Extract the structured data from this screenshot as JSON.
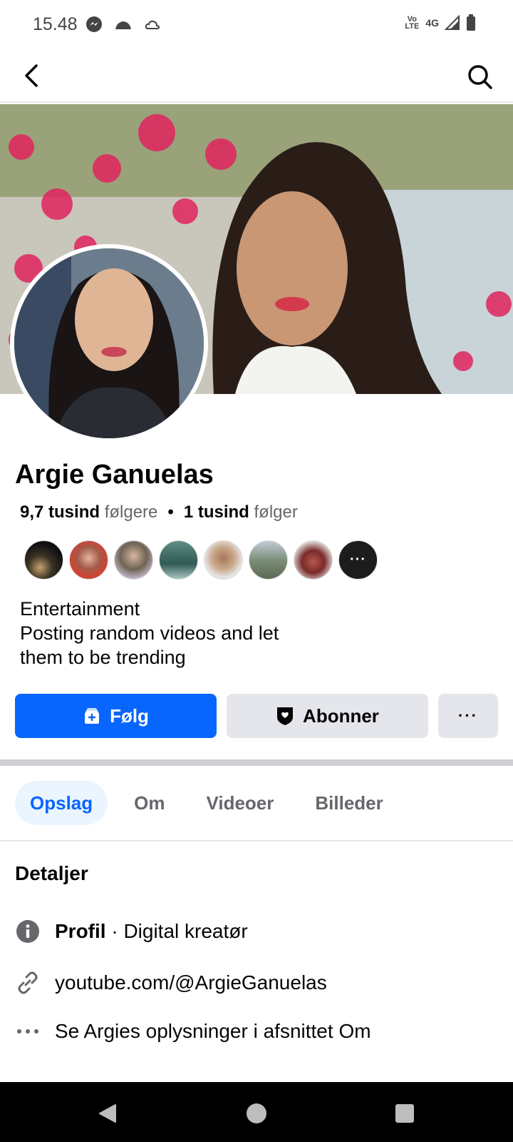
{
  "status_bar": {
    "time": "15.48",
    "network": "4G",
    "volte": "Vo LTE"
  },
  "profile": {
    "name": "Argie Ganuelas",
    "followers_count": "9,7 tusind",
    "followers_label": "følgere",
    "following_count": "1 tusind",
    "following_label": "følger",
    "separator": "•",
    "bio_lines": [
      "Entertainment",
      "Posting random videos and let",
      "them to be trending"
    ]
  },
  "actions": {
    "follow_label": "Følg",
    "subscribe_label": "Abonner",
    "more_label": "···"
  },
  "tabs": [
    {
      "label": "Opslag",
      "active": true
    },
    {
      "label": "Om",
      "active": false
    },
    {
      "label": "Videoer",
      "active": false
    },
    {
      "label": "Billeder",
      "active": false
    }
  ],
  "details": {
    "title": "Detaljer",
    "profile_label": "Profil",
    "profile_value": " · Digital kreatør",
    "link": "youtube.com/@ArgieGanuelas",
    "see_more": "Se Argies oplysninger i afsnittet Om"
  },
  "friends_more_label": "···",
  "icons": {
    "back": "back-arrow-icon",
    "search": "search-icon",
    "follow": "follow-icon",
    "subscribe": "subscribe-shield-icon",
    "info": "info-icon",
    "link": "link-icon",
    "more": "more-dots-icon"
  },
  "colors": {
    "accent": "#0866ff",
    "button_gray": "#e4e6eb",
    "tab_active_bg": "#ebf5ff",
    "text_secondary": "#65676b"
  }
}
